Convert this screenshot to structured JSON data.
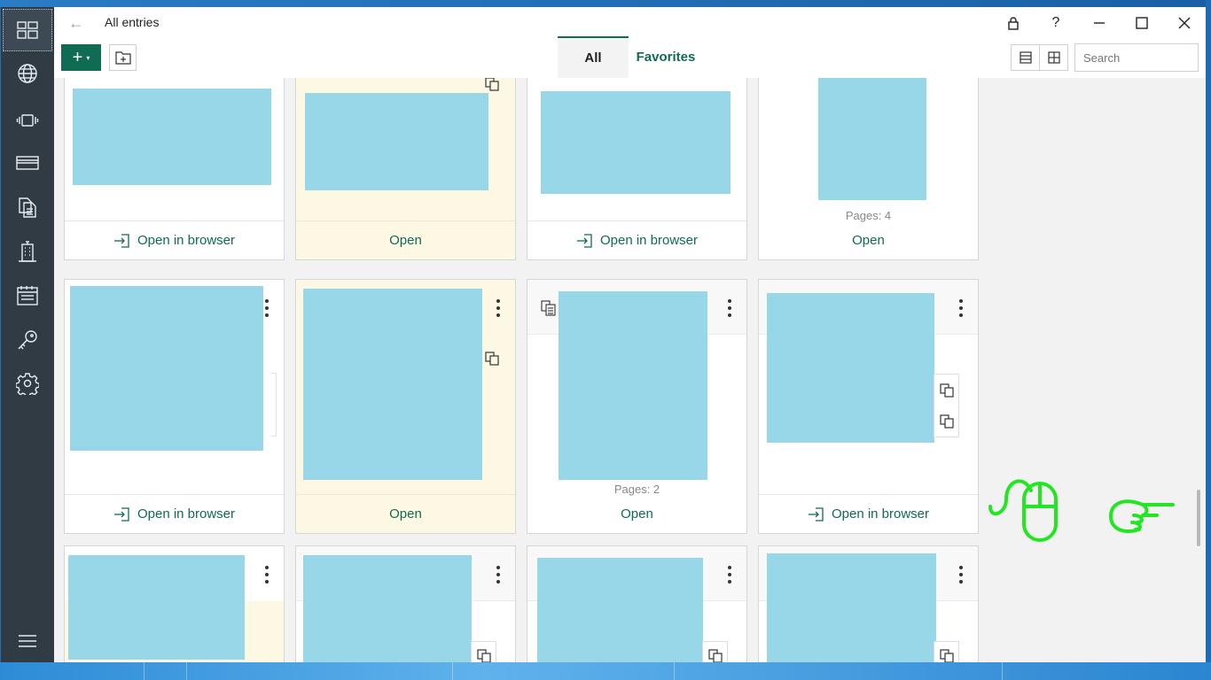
{
  "window": {
    "title": "All entries",
    "back_symbol": "←"
  },
  "sidebar": {
    "items": [
      {
        "name": "all-entries",
        "icon": "grid-icon"
      },
      {
        "name": "websites",
        "icon": "globe-icon"
      },
      {
        "name": "apps",
        "icon": "app-icon"
      },
      {
        "name": "bank-cards",
        "icon": "card-icon"
      },
      {
        "name": "documents",
        "icon": "documents-icon"
      },
      {
        "name": "addresses",
        "icon": "building-icon"
      },
      {
        "name": "notes",
        "icon": "calendar-icon"
      },
      {
        "name": "password-generator",
        "icon": "key-icon"
      },
      {
        "name": "settings",
        "icon": "gear-icon"
      },
      {
        "name": "menu",
        "icon": "hamburger-icon"
      }
    ]
  },
  "toolbar": {
    "add_symbol": "+",
    "add_caret": "▾",
    "tabs": {
      "all": "All",
      "favorites": "Favorites"
    },
    "search_placeholder": "Search",
    "window_controls": {
      "help": "?"
    }
  },
  "cards": {
    "row1": [
      {
        "action": "Open in browser",
        "favorite": false
      },
      {
        "action": "Open",
        "favorite": true
      },
      {
        "action": "Open in browser",
        "favorite": false
      },
      {
        "action": "Open",
        "favorite": false,
        "pages": "Pages: 4"
      }
    ],
    "row2": [
      {
        "action": "Open in browser",
        "favorite": false
      },
      {
        "action": "Open",
        "favorite": true
      },
      {
        "action": "Open",
        "favorite": false,
        "pages": "Pages: 2"
      },
      {
        "action": "Open in browser",
        "favorite": false
      }
    ]
  },
  "colors": {
    "accent": "#0f6b53",
    "thumbnail": "#98d7e8",
    "favorite_bg": "#fdf8e4",
    "rail_bg": "#303b44",
    "overlay": "#22e622"
  },
  "overlay_icons": [
    "mouse-icon",
    "pointing-hand-icon"
  ]
}
